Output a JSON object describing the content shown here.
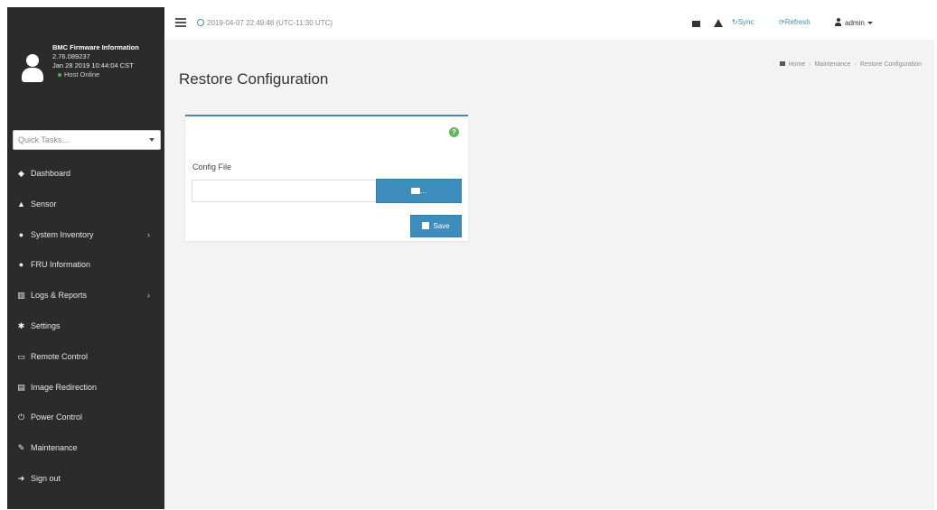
{
  "sidebar": {
    "profile": {
      "title": "BMC Firmware Information",
      "version": "2.76.089237",
      "date": "Jan 28 2019 10:44:04 CST",
      "status": "Host Online"
    },
    "quick_tasks_placeholder": "Quick Tasks...",
    "items": [
      {
        "label": "Dashboard",
        "icon": "tachometer-icon"
      },
      {
        "label": "Sensor",
        "icon": "sensor-icon"
      },
      {
        "label": "System Inventory",
        "icon": "info-icon",
        "has_submenu": true
      },
      {
        "label": "FRU Information",
        "icon": "info-icon"
      },
      {
        "label": "Logs & Reports",
        "icon": "bar-chart-icon",
        "has_submenu": true
      },
      {
        "label": "Settings",
        "icon": "gear-icon"
      },
      {
        "label": "Remote Control",
        "icon": "monitor-icon"
      },
      {
        "label": "Image Redirection",
        "icon": "disc-icon"
      },
      {
        "label": "Power Control",
        "icon": "power-icon"
      },
      {
        "label": "Maintenance",
        "icon": "wrench-icon"
      },
      {
        "label": "Sign out",
        "icon": "sign-out-icon"
      }
    ]
  },
  "header": {
    "datetime": "2019-04-07 22:49:46 (UTC-11:30 UTC)",
    "sync_label": "Sync",
    "refresh_label": "Refresh",
    "user_label": "admin"
  },
  "page": {
    "title": "Restore Configuration",
    "breadcrumb": [
      "Home",
      "Maintenance",
      "Restore Configuration"
    ]
  },
  "form": {
    "config_file_label": "Config File",
    "config_file_value": "",
    "browse_label": "...",
    "save_label": "Save"
  },
  "colors": {
    "sidebar_bg": "#2b2b2b",
    "accent": "#3c8dbc",
    "help": "#5cb85c",
    "content_bg": "#f3f3f3"
  }
}
